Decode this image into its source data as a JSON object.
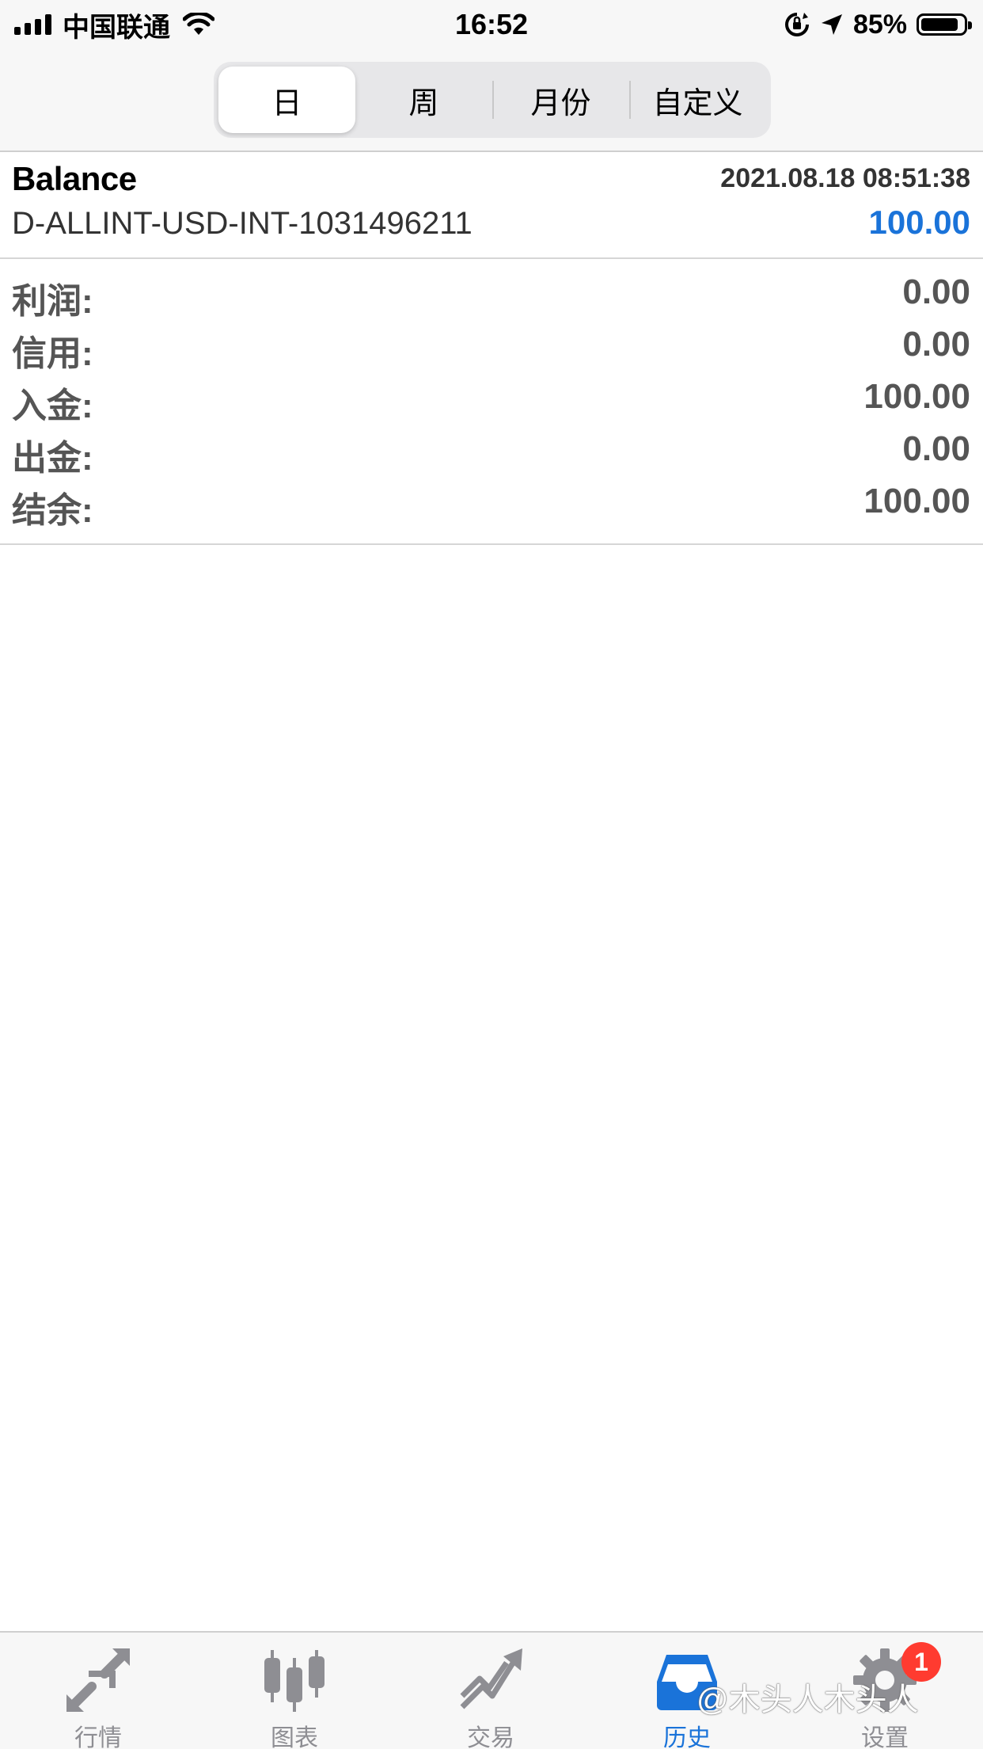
{
  "status_bar": {
    "carrier": "中国联通",
    "time": "16:52",
    "battery_percent": "85%"
  },
  "period_tabs": [
    {
      "label": "日",
      "active": true
    },
    {
      "label": "周",
      "active": false
    },
    {
      "label": "月份",
      "active": false
    },
    {
      "label": "自定义",
      "active": false
    }
  ],
  "record": {
    "type": "Balance",
    "datetime": "2021.08.18 08:51:38",
    "account": "D-ALLINT-USD-INT-1031496211",
    "amount": "100.00"
  },
  "summary": [
    {
      "label": "利润:",
      "value": "0.00"
    },
    {
      "label": "信用:",
      "value": "0.00"
    },
    {
      "label": "入金:",
      "value": "100.00"
    },
    {
      "label": "出金:",
      "value": "0.00"
    },
    {
      "label": "结余:",
      "value": "100.00"
    }
  ],
  "tab_bar": {
    "items": [
      {
        "label": "行情",
        "icon": "quotes-arrows-icon",
        "active": false
      },
      {
        "label": "图表",
        "icon": "candlestick-chart-icon",
        "active": false
      },
      {
        "label": "交易",
        "icon": "trade-trend-icon",
        "active": false
      },
      {
        "label": "历史",
        "icon": "history-inbox-icon",
        "active": true
      },
      {
        "label": "设置",
        "icon": "gear-icon",
        "active": false,
        "badge": "1"
      }
    ]
  },
  "watermark": "@木头人木头人",
  "colors": {
    "accent": "#1a73d9",
    "badge": "#ff3b30",
    "inactive_icon": "#8e8e93"
  }
}
